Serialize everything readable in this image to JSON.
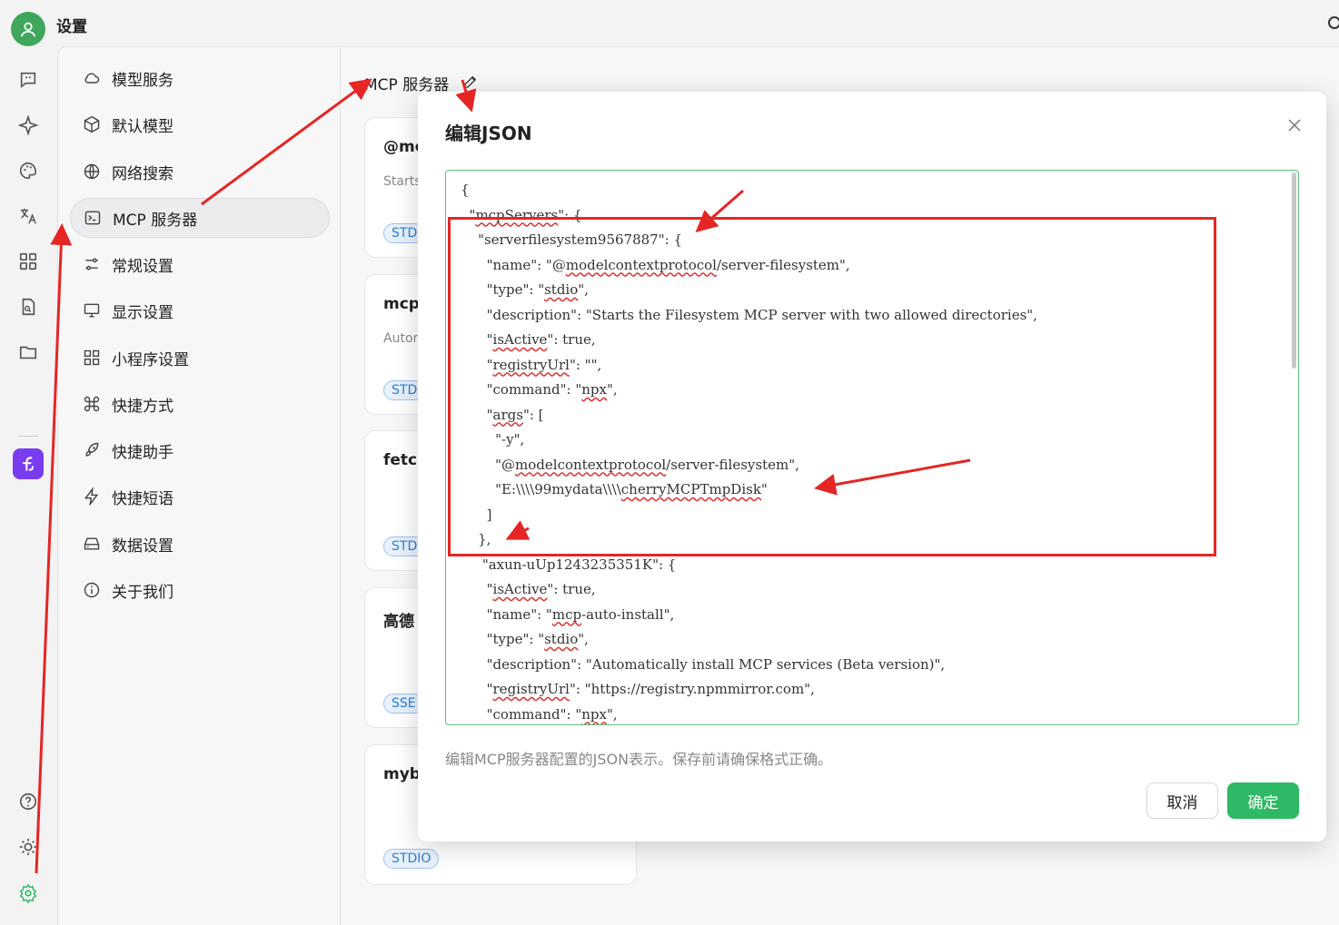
{
  "app": {
    "title": "设置"
  },
  "rail": {
    "icons": [
      "chat-icon",
      "sparkle-icon",
      "palette-icon",
      "translate-icon",
      "grid-icon",
      "document-search-icon",
      "folder-icon"
    ],
    "app_icon": "app-logo-icon",
    "bottom_icons": [
      "help-icon",
      "theme-icon",
      "settings-icon"
    ]
  },
  "menu": {
    "items": [
      {
        "label": "模型服务",
        "icon": "cloud-icon"
      },
      {
        "label": "默认模型",
        "icon": "cube-icon"
      },
      {
        "label": "网络搜索",
        "icon": "globe-icon"
      },
      {
        "label": "MCP 服务器",
        "icon": "terminal-icon",
        "active": true
      },
      {
        "label": "常规设置",
        "icon": "sliders-icon"
      },
      {
        "label": "显示设置",
        "icon": "monitor-icon"
      },
      {
        "label": "小程序设置",
        "icon": "grid-icon"
      },
      {
        "label": "快捷方式",
        "icon": "command-icon"
      },
      {
        "label": "快捷助手",
        "icon": "rocket-icon"
      },
      {
        "label": "快捷短语",
        "icon": "zap-icon"
      },
      {
        "label": "数据设置",
        "icon": "hard-drive-icon"
      },
      {
        "label": "关于我们",
        "icon": "info-icon"
      }
    ]
  },
  "content": {
    "title": "MCP 服务器",
    "cards": [
      {
        "name": "@mo",
        "desc": "Starts",
        "badge": "STD"
      },
      {
        "name": "mcp-",
        "desc": "Autor",
        "badge": "STD"
      },
      {
        "name": "fetcl",
        "desc": "",
        "badge": "STD"
      },
      {
        "name": "高德",
        "desc": "",
        "badge": "SSE"
      },
      {
        "name": "myb",
        "desc": "",
        "badge": "STDIO"
      }
    ]
  },
  "dialog": {
    "title": "编辑JSON",
    "json_text": "{\n  \"mcpServers\": {\n    \"serverfilesystem9567887\": {\n      \"name\": \"@modelcontextprotocol/server-filesystem\",\n      \"type\": \"stdio\",\n      \"description\": \"Starts the Filesystem MCP server with two allowed directories\",\n      \"isActive\": true,\n      \"registryUrl\": \"\",\n      \"command\": \"npx\",\n      \"args\": [\n        \"-y\",\n        \"@modelcontextprotocol/server-filesystem\",\n        \"E:\\\\\\\\99mydata\\\\\\\\cherryMCPTmpDisk\"\n      ]\n    },\n     \"axun-uUp1243235351K\": {\n      \"isActive\": true,\n      \"name\": \"mcp-auto-install\",\n      \"type\": \"stdio\",\n      \"description\": \"Automatically install MCP services (Beta version)\",\n      \"registryUrl\": \"https://registry.npmmirror.com\",\n      \"command\": \"npx\",",
    "helper_text": "编辑MCP服务器配置的JSON表示。保存前请确保格式正确。",
    "cancel_label": "取消",
    "ok_label": "确定"
  },
  "colors": {
    "accent": "#2fb865",
    "highlight": "#e62525",
    "badge": "#2d7fd8"
  }
}
